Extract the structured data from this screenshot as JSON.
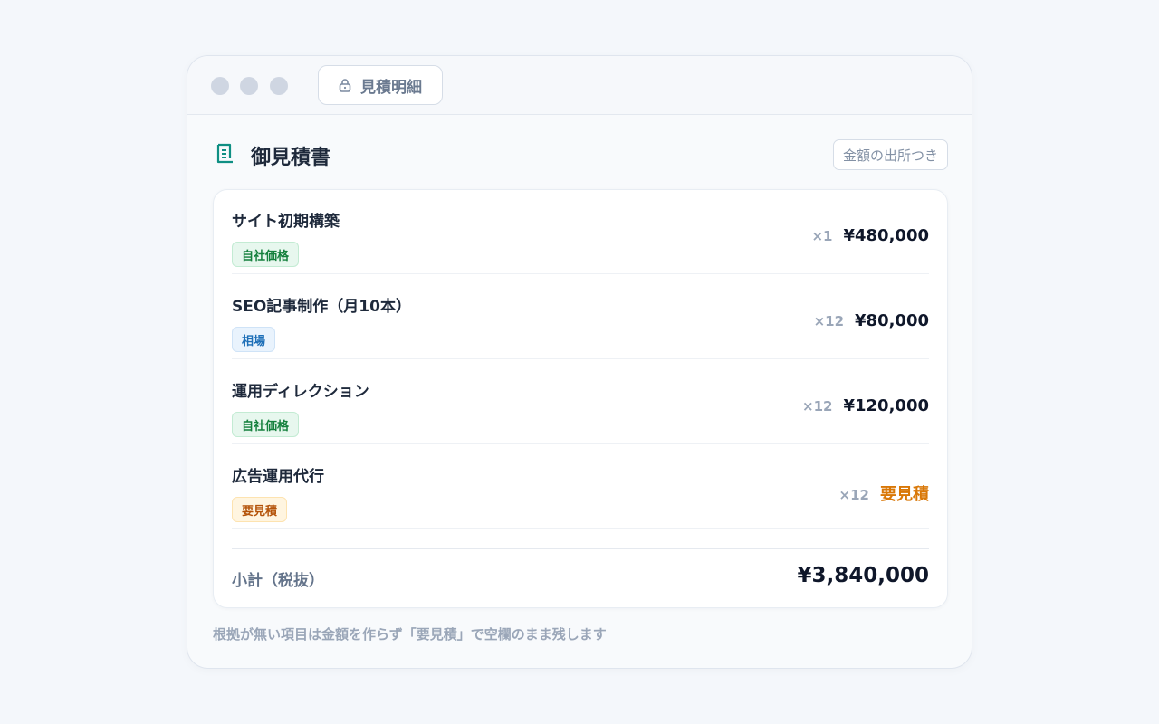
{
  "window": {
    "tab_label": "見積明細",
    "tab_icon": "lock-icon"
  },
  "header": {
    "title": "御見積書",
    "title_icon": "receipt-icon",
    "source_badge": "金額の出所つき"
  },
  "items": [
    {
      "name": "サイト初期構築",
      "tag": "自社価格",
      "tag_type": "own",
      "qty": "×1",
      "price": "¥480,000"
    },
    {
      "name": "SEO記事制作（月10本）",
      "tag": "相場",
      "tag_type": "market",
      "qty": "×12",
      "price": "¥80,000"
    },
    {
      "name": "運用ディレクション",
      "tag": "自社価格",
      "tag_type": "own",
      "qty": "×12",
      "price": "¥120,000"
    },
    {
      "name": "広告運用代行",
      "tag": "要見積",
      "tag_type": "quote",
      "qty": "×12",
      "price": "要見積"
    }
  ],
  "subtotal": {
    "label": "小計（税抜）",
    "value": "¥3,840,000"
  },
  "footnote": "根拠が無い項目は金額を作らず「要見積」で空欄のまま残します",
  "colors": {
    "accent": "#0f8f83",
    "own_tag": "#15803d",
    "market_tag": "#1d6fb8",
    "quote_tag": "#b45309",
    "pending_price": "#d97706"
  }
}
